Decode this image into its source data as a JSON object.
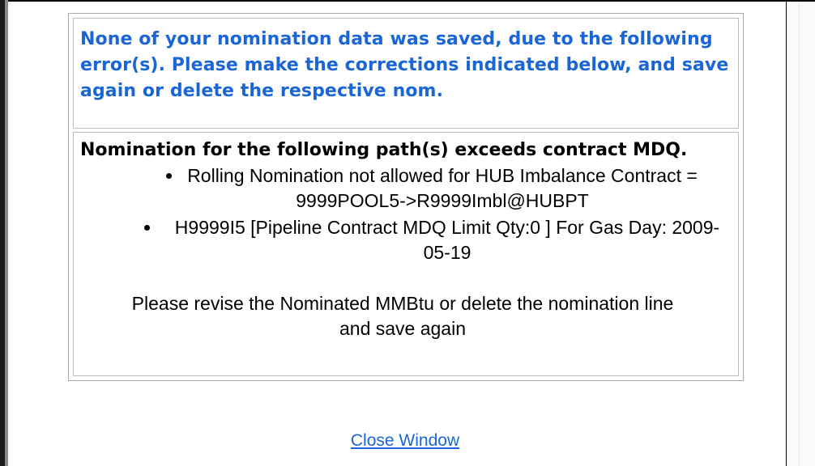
{
  "error_panel": {
    "header_message": "None of your nomination data was saved, due to the following error(s). Please make the corrections indicated below, and save again or delete the respective nom.",
    "summary": "Nomination for the following path(s) exceeds contract MDQ.",
    "errors": [
      "Rolling Nomination not allowed for HUB Imbalance Contract = 9999POOL5->R9999Imbl@HUBPT",
      "H9999I5 [Pipeline Contract MDQ Limit Qty:0 ] For Gas Day: 2009-05-19"
    ],
    "revise_message": "Please revise the Nominated MMBtu or delete the nomination line and save again"
  },
  "actions": {
    "close_window": "Close Window"
  },
  "colors": {
    "header_text": "#1a66d6",
    "link": "#1a66d6",
    "body_text": "#000000",
    "table_border": "#a9a9a9"
  }
}
